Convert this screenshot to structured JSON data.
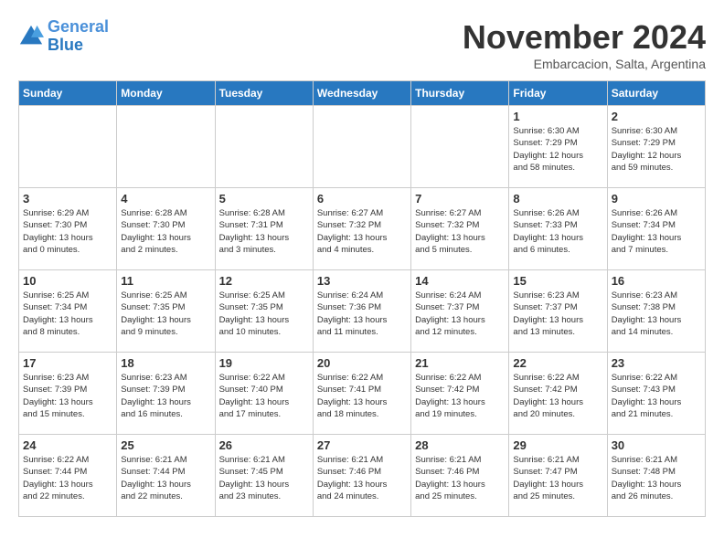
{
  "header": {
    "logo_line1": "General",
    "logo_line2": "Blue",
    "month": "November 2024",
    "location": "Embarcacion, Salta, Argentina"
  },
  "days_of_week": [
    "Sunday",
    "Monday",
    "Tuesday",
    "Wednesday",
    "Thursday",
    "Friday",
    "Saturday"
  ],
  "weeks": [
    [
      {
        "day": "",
        "info": ""
      },
      {
        "day": "",
        "info": ""
      },
      {
        "day": "",
        "info": ""
      },
      {
        "day": "",
        "info": ""
      },
      {
        "day": "",
        "info": ""
      },
      {
        "day": "1",
        "info": "Sunrise: 6:30 AM\nSunset: 7:29 PM\nDaylight: 12 hours\nand 58 minutes."
      },
      {
        "day": "2",
        "info": "Sunrise: 6:30 AM\nSunset: 7:29 PM\nDaylight: 12 hours\nand 59 minutes."
      }
    ],
    [
      {
        "day": "3",
        "info": "Sunrise: 6:29 AM\nSunset: 7:30 PM\nDaylight: 13 hours\nand 0 minutes."
      },
      {
        "day": "4",
        "info": "Sunrise: 6:28 AM\nSunset: 7:30 PM\nDaylight: 13 hours\nand 2 minutes."
      },
      {
        "day": "5",
        "info": "Sunrise: 6:28 AM\nSunset: 7:31 PM\nDaylight: 13 hours\nand 3 minutes."
      },
      {
        "day": "6",
        "info": "Sunrise: 6:27 AM\nSunset: 7:32 PM\nDaylight: 13 hours\nand 4 minutes."
      },
      {
        "day": "7",
        "info": "Sunrise: 6:27 AM\nSunset: 7:32 PM\nDaylight: 13 hours\nand 5 minutes."
      },
      {
        "day": "8",
        "info": "Sunrise: 6:26 AM\nSunset: 7:33 PM\nDaylight: 13 hours\nand 6 minutes."
      },
      {
        "day": "9",
        "info": "Sunrise: 6:26 AM\nSunset: 7:34 PM\nDaylight: 13 hours\nand 7 minutes."
      }
    ],
    [
      {
        "day": "10",
        "info": "Sunrise: 6:25 AM\nSunset: 7:34 PM\nDaylight: 13 hours\nand 8 minutes."
      },
      {
        "day": "11",
        "info": "Sunrise: 6:25 AM\nSunset: 7:35 PM\nDaylight: 13 hours\nand 9 minutes."
      },
      {
        "day": "12",
        "info": "Sunrise: 6:25 AM\nSunset: 7:35 PM\nDaylight: 13 hours\nand 10 minutes."
      },
      {
        "day": "13",
        "info": "Sunrise: 6:24 AM\nSunset: 7:36 PM\nDaylight: 13 hours\nand 11 minutes."
      },
      {
        "day": "14",
        "info": "Sunrise: 6:24 AM\nSunset: 7:37 PM\nDaylight: 13 hours\nand 12 minutes."
      },
      {
        "day": "15",
        "info": "Sunrise: 6:23 AM\nSunset: 7:37 PM\nDaylight: 13 hours\nand 13 minutes."
      },
      {
        "day": "16",
        "info": "Sunrise: 6:23 AM\nSunset: 7:38 PM\nDaylight: 13 hours\nand 14 minutes."
      }
    ],
    [
      {
        "day": "17",
        "info": "Sunrise: 6:23 AM\nSunset: 7:39 PM\nDaylight: 13 hours\nand 15 minutes."
      },
      {
        "day": "18",
        "info": "Sunrise: 6:23 AM\nSunset: 7:39 PM\nDaylight: 13 hours\nand 16 minutes."
      },
      {
        "day": "19",
        "info": "Sunrise: 6:22 AM\nSunset: 7:40 PM\nDaylight: 13 hours\nand 17 minutes."
      },
      {
        "day": "20",
        "info": "Sunrise: 6:22 AM\nSunset: 7:41 PM\nDaylight: 13 hours\nand 18 minutes."
      },
      {
        "day": "21",
        "info": "Sunrise: 6:22 AM\nSunset: 7:42 PM\nDaylight: 13 hours\nand 19 minutes."
      },
      {
        "day": "22",
        "info": "Sunrise: 6:22 AM\nSunset: 7:42 PM\nDaylight: 13 hours\nand 20 minutes."
      },
      {
        "day": "23",
        "info": "Sunrise: 6:22 AM\nSunset: 7:43 PM\nDaylight: 13 hours\nand 21 minutes."
      }
    ],
    [
      {
        "day": "24",
        "info": "Sunrise: 6:22 AM\nSunset: 7:44 PM\nDaylight: 13 hours\nand 22 minutes."
      },
      {
        "day": "25",
        "info": "Sunrise: 6:21 AM\nSunset: 7:44 PM\nDaylight: 13 hours\nand 22 minutes."
      },
      {
        "day": "26",
        "info": "Sunrise: 6:21 AM\nSunset: 7:45 PM\nDaylight: 13 hours\nand 23 minutes."
      },
      {
        "day": "27",
        "info": "Sunrise: 6:21 AM\nSunset: 7:46 PM\nDaylight: 13 hours\nand 24 minutes."
      },
      {
        "day": "28",
        "info": "Sunrise: 6:21 AM\nSunset: 7:46 PM\nDaylight: 13 hours\nand 25 minutes."
      },
      {
        "day": "29",
        "info": "Sunrise: 6:21 AM\nSunset: 7:47 PM\nDaylight: 13 hours\nand 25 minutes."
      },
      {
        "day": "30",
        "info": "Sunrise: 6:21 AM\nSunset: 7:48 PM\nDaylight: 13 hours\nand 26 minutes."
      }
    ]
  ]
}
